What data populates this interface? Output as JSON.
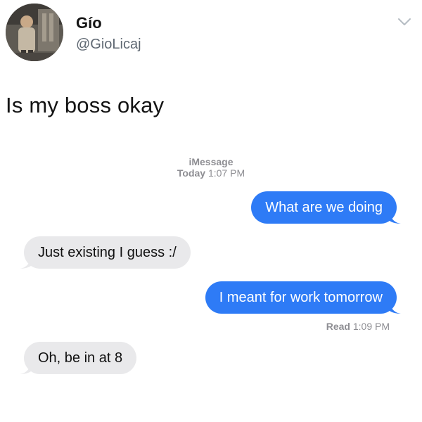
{
  "tweet": {
    "display_name": "Gío",
    "handle": "@GioLicaj",
    "text": "Is my boss okay"
  },
  "imessage": {
    "service_label": "iMessage",
    "day_label": "Today",
    "time": "1:07 PM",
    "messages": [
      {
        "direction": "sent",
        "text": "What are we doing"
      },
      {
        "direction": "received",
        "text": "Just existing I guess :/"
      },
      {
        "direction": "sent",
        "text": "I meant for work tomorrow"
      },
      {
        "direction": "received",
        "text": "Oh, be in at 8"
      }
    ],
    "read_receipt": {
      "label": "Read",
      "time": "1:09 PM"
    }
  },
  "colors": {
    "sent_bubble": "#2e7bf6",
    "received_bubble": "#e9e9eb",
    "meta_gray": "#8e8e93"
  },
  "icons": {
    "more_menu": "chevron-down-icon"
  }
}
